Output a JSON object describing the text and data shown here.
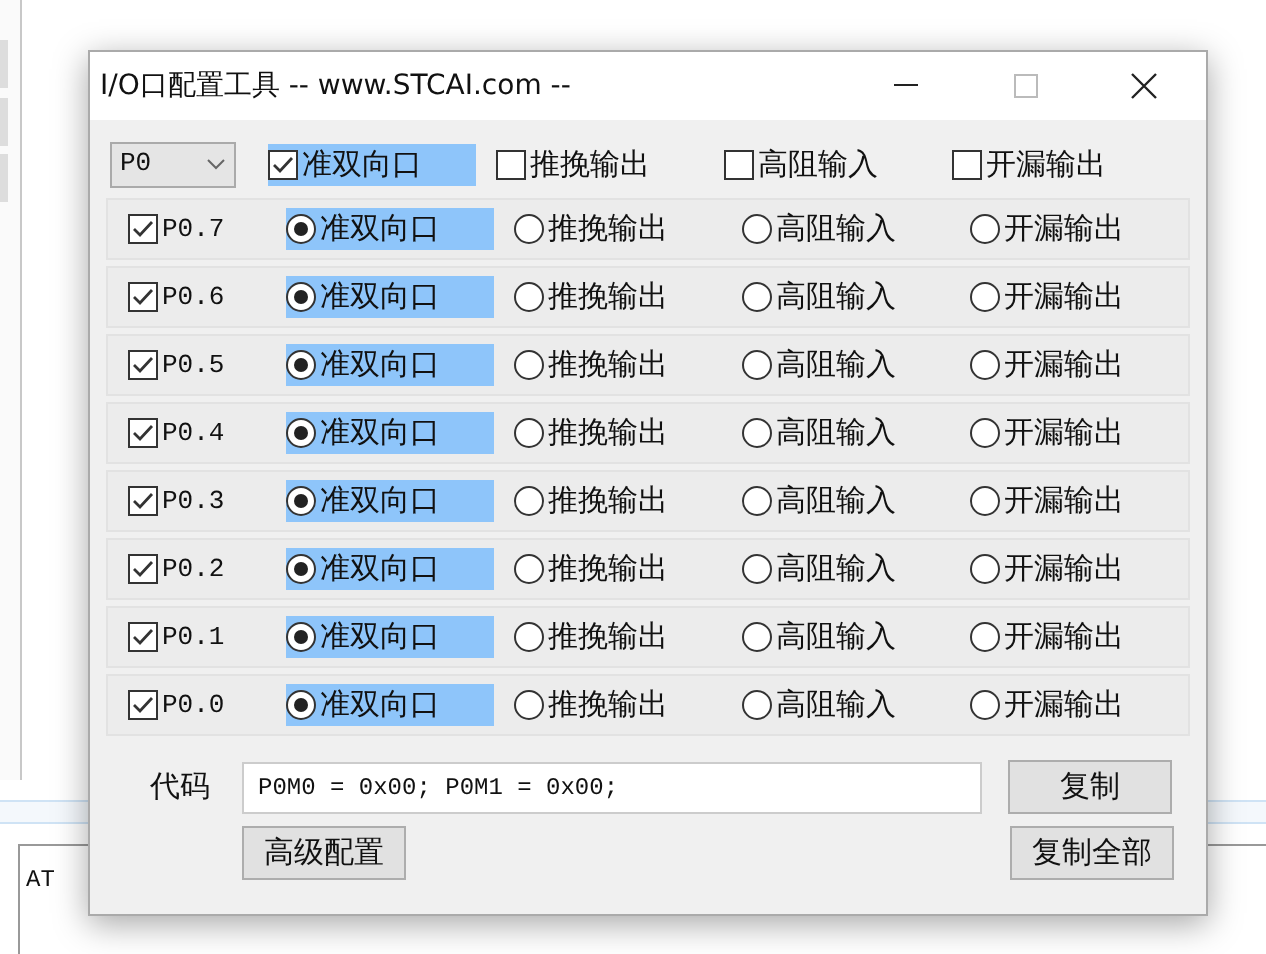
{
  "background": {
    "terminal_text": "AT"
  },
  "window": {
    "title": "I/O口配置工具 -- www.STCAI.com --"
  },
  "port_select": {
    "value": "P0"
  },
  "header_options": [
    {
      "label": "准双向口",
      "checked": true
    },
    {
      "label": "推挽输出",
      "checked": false
    },
    {
      "label": "高阻输入",
      "checked": false
    },
    {
      "label": "开漏输出",
      "checked": false
    }
  ],
  "pins": [
    {
      "label": "P0.7",
      "checked": true,
      "options": [
        {
          "label": "准双向口",
          "selected": true
        },
        {
          "label": "推挽输出",
          "selected": false
        },
        {
          "label": "高阻输入",
          "selected": false
        },
        {
          "label": "开漏输出",
          "selected": false
        }
      ]
    },
    {
      "label": "P0.6",
      "checked": true,
      "options": [
        {
          "label": "准双向口",
          "selected": true
        },
        {
          "label": "推挽输出",
          "selected": false
        },
        {
          "label": "高阻输入",
          "selected": false
        },
        {
          "label": "开漏输出",
          "selected": false
        }
      ]
    },
    {
      "label": "P0.5",
      "checked": true,
      "options": [
        {
          "label": "准双向口",
          "selected": true
        },
        {
          "label": "推挽输出",
          "selected": false
        },
        {
          "label": "高阻输入",
          "selected": false
        },
        {
          "label": "开漏输出",
          "selected": false
        }
      ]
    },
    {
      "label": "P0.4",
      "checked": true,
      "options": [
        {
          "label": "准双向口",
          "selected": true
        },
        {
          "label": "推挽输出",
          "selected": false
        },
        {
          "label": "高阻输入",
          "selected": false
        },
        {
          "label": "开漏输出",
          "selected": false
        }
      ]
    },
    {
      "label": "P0.3",
      "checked": true,
      "options": [
        {
          "label": "准双向口",
          "selected": true
        },
        {
          "label": "推挽输出",
          "selected": false
        },
        {
          "label": "高阻输入",
          "selected": false
        },
        {
          "label": "开漏输出",
          "selected": false
        }
      ]
    },
    {
      "label": "P0.2",
      "checked": true,
      "options": [
        {
          "label": "准双向口",
          "selected": true
        },
        {
          "label": "推挽输出",
          "selected": false
        },
        {
          "label": "高阻输入",
          "selected": false
        },
        {
          "label": "开漏输出",
          "selected": false
        }
      ]
    },
    {
      "label": "P0.1",
      "checked": true,
      "options": [
        {
          "label": "准双向口",
          "selected": true
        },
        {
          "label": "推挽输出",
          "selected": false
        },
        {
          "label": "高阻输入",
          "selected": false
        },
        {
          "label": "开漏输出",
          "selected": false
        }
      ]
    },
    {
      "label": "P0.0",
      "checked": true,
      "options": [
        {
          "label": "准双向口",
          "selected": true
        },
        {
          "label": "推挽输出",
          "selected": false
        },
        {
          "label": "高阻输入",
          "selected": false
        },
        {
          "label": "开漏输出",
          "selected": false
        }
      ]
    }
  ],
  "code": {
    "label": "代码",
    "value": "P0M0 = 0x00; P0M1 = 0x00;"
  },
  "buttons": {
    "copy": "复制",
    "advanced": "高级配置",
    "copy_all": "复制全部"
  }
}
